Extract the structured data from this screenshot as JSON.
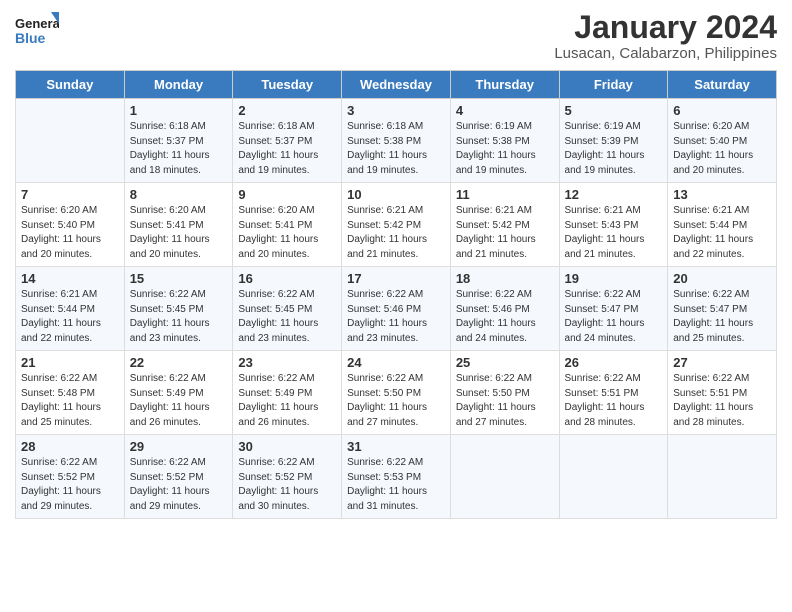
{
  "logo": {
    "line1": "General",
    "line2": "Blue"
  },
  "title": "January 2024",
  "subtitle": "Lusacan, Calabarzon, Philippines",
  "days": [
    "Sunday",
    "Monday",
    "Tuesday",
    "Wednesday",
    "Thursday",
    "Friday",
    "Saturday"
  ],
  "weeks": [
    [
      {
        "date": "",
        "info": ""
      },
      {
        "date": "1",
        "info": "Sunrise: 6:18 AM\nSunset: 5:37 PM\nDaylight: 11 hours\nand 18 minutes."
      },
      {
        "date": "2",
        "info": "Sunrise: 6:18 AM\nSunset: 5:37 PM\nDaylight: 11 hours\nand 19 minutes."
      },
      {
        "date": "3",
        "info": "Sunrise: 6:18 AM\nSunset: 5:38 PM\nDaylight: 11 hours\nand 19 minutes."
      },
      {
        "date": "4",
        "info": "Sunrise: 6:19 AM\nSunset: 5:38 PM\nDaylight: 11 hours\nand 19 minutes."
      },
      {
        "date": "5",
        "info": "Sunrise: 6:19 AM\nSunset: 5:39 PM\nDaylight: 11 hours\nand 19 minutes."
      },
      {
        "date": "6",
        "info": "Sunrise: 6:20 AM\nSunset: 5:40 PM\nDaylight: 11 hours\nand 20 minutes."
      }
    ],
    [
      {
        "date": "7",
        "info": "Sunrise: 6:20 AM\nSunset: 5:40 PM\nDaylight: 11 hours\nand 20 minutes."
      },
      {
        "date": "8",
        "info": "Sunrise: 6:20 AM\nSunset: 5:41 PM\nDaylight: 11 hours\nand 20 minutes."
      },
      {
        "date": "9",
        "info": "Sunrise: 6:20 AM\nSunset: 5:41 PM\nDaylight: 11 hours\nand 20 minutes."
      },
      {
        "date": "10",
        "info": "Sunrise: 6:21 AM\nSunset: 5:42 PM\nDaylight: 11 hours\nand 21 minutes."
      },
      {
        "date": "11",
        "info": "Sunrise: 6:21 AM\nSunset: 5:42 PM\nDaylight: 11 hours\nand 21 minutes."
      },
      {
        "date": "12",
        "info": "Sunrise: 6:21 AM\nSunset: 5:43 PM\nDaylight: 11 hours\nand 21 minutes."
      },
      {
        "date": "13",
        "info": "Sunrise: 6:21 AM\nSunset: 5:44 PM\nDaylight: 11 hours\nand 22 minutes."
      }
    ],
    [
      {
        "date": "14",
        "info": "Sunrise: 6:21 AM\nSunset: 5:44 PM\nDaylight: 11 hours\nand 22 minutes."
      },
      {
        "date": "15",
        "info": "Sunrise: 6:22 AM\nSunset: 5:45 PM\nDaylight: 11 hours\nand 23 minutes."
      },
      {
        "date": "16",
        "info": "Sunrise: 6:22 AM\nSunset: 5:45 PM\nDaylight: 11 hours\nand 23 minutes."
      },
      {
        "date": "17",
        "info": "Sunrise: 6:22 AM\nSunset: 5:46 PM\nDaylight: 11 hours\nand 23 minutes."
      },
      {
        "date": "18",
        "info": "Sunrise: 6:22 AM\nSunset: 5:46 PM\nDaylight: 11 hours\nand 24 minutes."
      },
      {
        "date": "19",
        "info": "Sunrise: 6:22 AM\nSunset: 5:47 PM\nDaylight: 11 hours\nand 24 minutes."
      },
      {
        "date": "20",
        "info": "Sunrise: 6:22 AM\nSunset: 5:47 PM\nDaylight: 11 hours\nand 25 minutes."
      }
    ],
    [
      {
        "date": "21",
        "info": "Sunrise: 6:22 AM\nSunset: 5:48 PM\nDaylight: 11 hours\nand 25 minutes."
      },
      {
        "date": "22",
        "info": "Sunrise: 6:22 AM\nSunset: 5:49 PM\nDaylight: 11 hours\nand 26 minutes."
      },
      {
        "date": "23",
        "info": "Sunrise: 6:22 AM\nSunset: 5:49 PM\nDaylight: 11 hours\nand 26 minutes."
      },
      {
        "date": "24",
        "info": "Sunrise: 6:22 AM\nSunset: 5:50 PM\nDaylight: 11 hours\nand 27 minutes."
      },
      {
        "date": "25",
        "info": "Sunrise: 6:22 AM\nSunset: 5:50 PM\nDaylight: 11 hours\nand 27 minutes."
      },
      {
        "date": "26",
        "info": "Sunrise: 6:22 AM\nSunset: 5:51 PM\nDaylight: 11 hours\nand 28 minutes."
      },
      {
        "date": "27",
        "info": "Sunrise: 6:22 AM\nSunset: 5:51 PM\nDaylight: 11 hours\nand 28 minutes."
      }
    ],
    [
      {
        "date": "28",
        "info": "Sunrise: 6:22 AM\nSunset: 5:52 PM\nDaylight: 11 hours\nand 29 minutes."
      },
      {
        "date": "29",
        "info": "Sunrise: 6:22 AM\nSunset: 5:52 PM\nDaylight: 11 hours\nand 29 minutes."
      },
      {
        "date": "30",
        "info": "Sunrise: 6:22 AM\nSunset: 5:52 PM\nDaylight: 11 hours\nand 30 minutes."
      },
      {
        "date": "31",
        "info": "Sunrise: 6:22 AM\nSunset: 5:53 PM\nDaylight: 11 hours\nand 31 minutes."
      },
      {
        "date": "",
        "info": ""
      },
      {
        "date": "",
        "info": ""
      },
      {
        "date": "",
        "info": ""
      }
    ]
  ]
}
